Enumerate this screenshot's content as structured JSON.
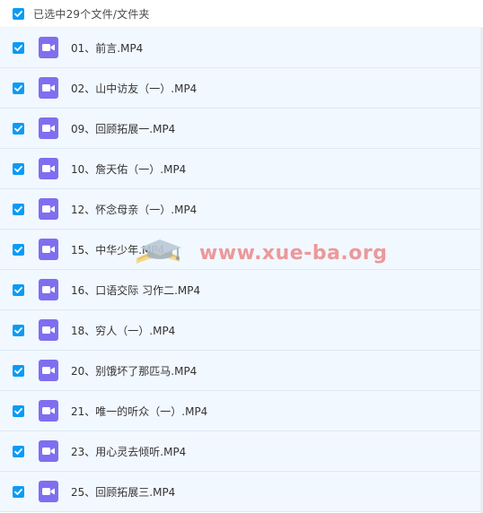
{
  "header": {
    "selection_text": "已选中29个文件/文件夹",
    "select_all_checked": true
  },
  "files": [
    {
      "name": "01、前言.MP4",
      "checked": true,
      "icon": "video-file-icon"
    },
    {
      "name": "02、山中访友（一）.MP4",
      "checked": true,
      "icon": "video-file-icon"
    },
    {
      "name": "09、回顾拓展一.MP4",
      "checked": true,
      "icon": "video-file-icon"
    },
    {
      "name": "10、詹天佑（一）.MP4",
      "checked": true,
      "icon": "video-file-icon"
    },
    {
      "name": "12、怀念母亲（一）.MP4",
      "checked": true,
      "icon": "video-file-icon"
    },
    {
      "name": "15、中华少年.MP4",
      "checked": true,
      "icon": "video-file-icon"
    },
    {
      "name": "16、口语交际 习作二.MP4",
      "checked": true,
      "icon": "video-file-icon"
    },
    {
      "name": "18、穷人（一）.MP4",
      "checked": true,
      "icon": "video-file-icon"
    },
    {
      "name": "20、别饿坏了那匹马.MP4",
      "checked": true,
      "icon": "video-file-icon"
    },
    {
      "name": "21、唯一的听众（一）.MP4",
      "checked": true,
      "icon": "video-file-icon"
    },
    {
      "name": "23、用心灵去倾听.MP4",
      "checked": true,
      "icon": "video-file-icon"
    },
    {
      "name": "25、回顾拓展三.MP4",
      "checked": true,
      "icon": "video-file-icon"
    }
  ],
  "watermark": {
    "text": "www.xue-ba.org",
    "icon": "graduation-cap-icon"
  },
  "colors": {
    "checkbox": "#0a9bf5",
    "video_icon": "#7f6ef0",
    "row_background": "#f2f8ff",
    "watermark": "#e87a78"
  }
}
